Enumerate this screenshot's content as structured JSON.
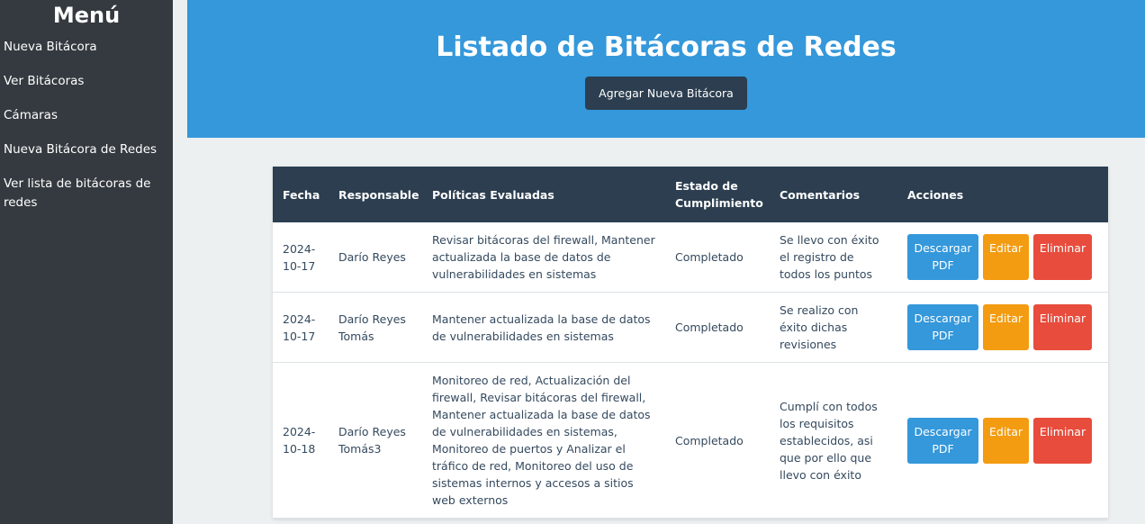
{
  "sidebar": {
    "title": "Menú",
    "items": [
      {
        "label": "Nueva Bitácora"
      },
      {
        "label": "Ver Bitácoras"
      },
      {
        "label": "Cámaras"
      },
      {
        "label": "Nueva Bitácora de Redes"
      },
      {
        "label": "Ver lista de bitácoras de redes"
      }
    ]
  },
  "header": {
    "title": "Listado de Bitácoras de Redes",
    "add_button": "Agregar Nueva Bitácora"
  },
  "table": {
    "headers": {
      "fecha": "Fecha",
      "responsable": "Responsable",
      "politicas": "Políticas Evaluadas",
      "estado": "Estado de Cumplimiento",
      "comentarios": "Comentarios",
      "acciones": "Acciones"
    },
    "rows": [
      {
        "fecha": "2024-10-17",
        "responsable": "Darío Reyes",
        "politicas": "Revisar bitácoras del firewall, Mantener actualizada la base de datos de vulnerabilidades en sistemas",
        "estado": "Completado",
        "comentarios": "Se llevo con éxito el registro de todos los puntos"
      },
      {
        "fecha": "2024-10-17",
        "responsable": "Darío Reyes Tomás",
        "politicas": "Mantener actualizada la base de datos de vulnerabilidades en sistemas",
        "estado": "Completado",
        "comentarios": "Se realizo con éxito dichas revisiones"
      },
      {
        "fecha": "2024-10-18",
        "responsable": "Darío Reyes Tomás3",
        "politicas": "Monitoreo de red, Actualización del firewall, Revisar bitácoras del firewall, Mantener actualizada la base de datos de vulnerabilidades en sistemas, Monitoreo de puertos y Analizar el tráfico de red, Monitoreo del uso de sistemas internos y accesos a sitios web externos",
        "estado": "Completado",
        "comentarios": "Cumplí con todos los requisitos establecidos, asi que por ello que llevo con éxito"
      }
    ],
    "actions": {
      "pdf": "Descargar PDF",
      "edit": "Editar",
      "delete": "Eliminar"
    }
  },
  "colors": {
    "sidebar_bg": "#343a40",
    "header_bg": "#3498db",
    "table_header_bg": "#2c3e50",
    "pdf_button": "#3498db",
    "edit_button": "#f39c12",
    "delete_button": "#e74c3c",
    "page_bg": "#ecf0f1"
  }
}
